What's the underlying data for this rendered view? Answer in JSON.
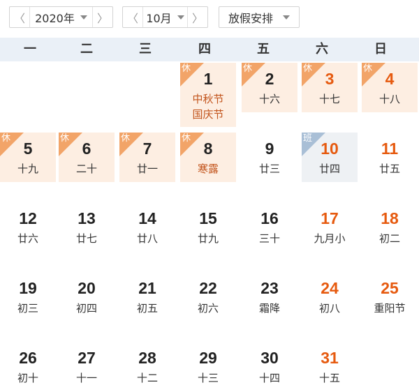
{
  "toolbar": {
    "year": "2020年",
    "month": "10月",
    "holiday_label": "放假安排",
    "prev_glyph": "〈",
    "next_glyph": "〉"
  },
  "weekdays": [
    "一",
    "二",
    "三",
    "四",
    "五",
    "六",
    "日"
  ],
  "badges": {
    "rest": "休",
    "work": "班"
  },
  "colors": {
    "weekend_red": "#e65a0f",
    "rest_bg": "#fdeee2",
    "rest_badge": "#f2a468",
    "work_bg": "#eef1f4",
    "work_badge": "#a9bfd6",
    "header_bg": "#eaf0f7"
  },
  "days": [
    {
      "day": "1",
      "lunar": "中秋节",
      "lunar2": "国庆节",
      "badge": "休",
      "fest": true
    },
    {
      "day": "2",
      "lunar": "十六",
      "badge": "休"
    },
    {
      "day": "3",
      "lunar": "十七",
      "badge": "休",
      "red": true
    },
    {
      "day": "4",
      "lunar": "十八",
      "badge": "休",
      "red": true
    },
    {
      "day": "5",
      "lunar": "十九",
      "badge": "休"
    },
    {
      "day": "6",
      "lunar": "二十",
      "badge": "休"
    },
    {
      "day": "7",
      "lunar": "廿一",
      "badge": "休"
    },
    {
      "day": "8",
      "lunar": "寒露",
      "badge": "休",
      "fest": true
    },
    {
      "day": "9",
      "lunar": "廿三"
    },
    {
      "day": "10",
      "lunar": "廿四",
      "badge": "班",
      "red": true
    },
    {
      "day": "11",
      "lunar": "廿五",
      "red": true
    },
    {
      "day": "12",
      "lunar": "廿六"
    },
    {
      "day": "13",
      "lunar": "廿七"
    },
    {
      "day": "14",
      "lunar": "廿八"
    },
    {
      "day": "15",
      "lunar": "廿九"
    },
    {
      "day": "16",
      "lunar": "三十"
    },
    {
      "day": "17",
      "lunar": "九月小",
      "red": true
    },
    {
      "day": "18",
      "lunar": "初二",
      "red": true
    },
    {
      "day": "19",
      "lunar": "初三"
    },
    {
      "day": "20",
      "lunar": "初四"
    },
    {
      "day": "21",
      "lunar": "初五"
    },
    {
      "day": "22",
      "lunar": "初六"
    },
    {
      "day": "23",
      "lunar": "霜降"
    },
    {
      "day": "24",
      "lunar": "初八",
      "red": true
    },
    {
      "day": "25",
      "lunar": "重阳节",
      "red": true
    },
    {
      "day": "26",
      "lunar": "初十"
    },
    {
      "day": "27",
      "lunar": "十一"
    },
    {
      "day": "28",
      "lunar": "十二"
    },
    {
      "day": "29",
      "lunar": "十三"
    },
    {
      "day": "30",
      "lunar": "十四"
    },
    {
      "day": "31",
      "lunar": "十五",
      "red": true
    }
  ]
}
